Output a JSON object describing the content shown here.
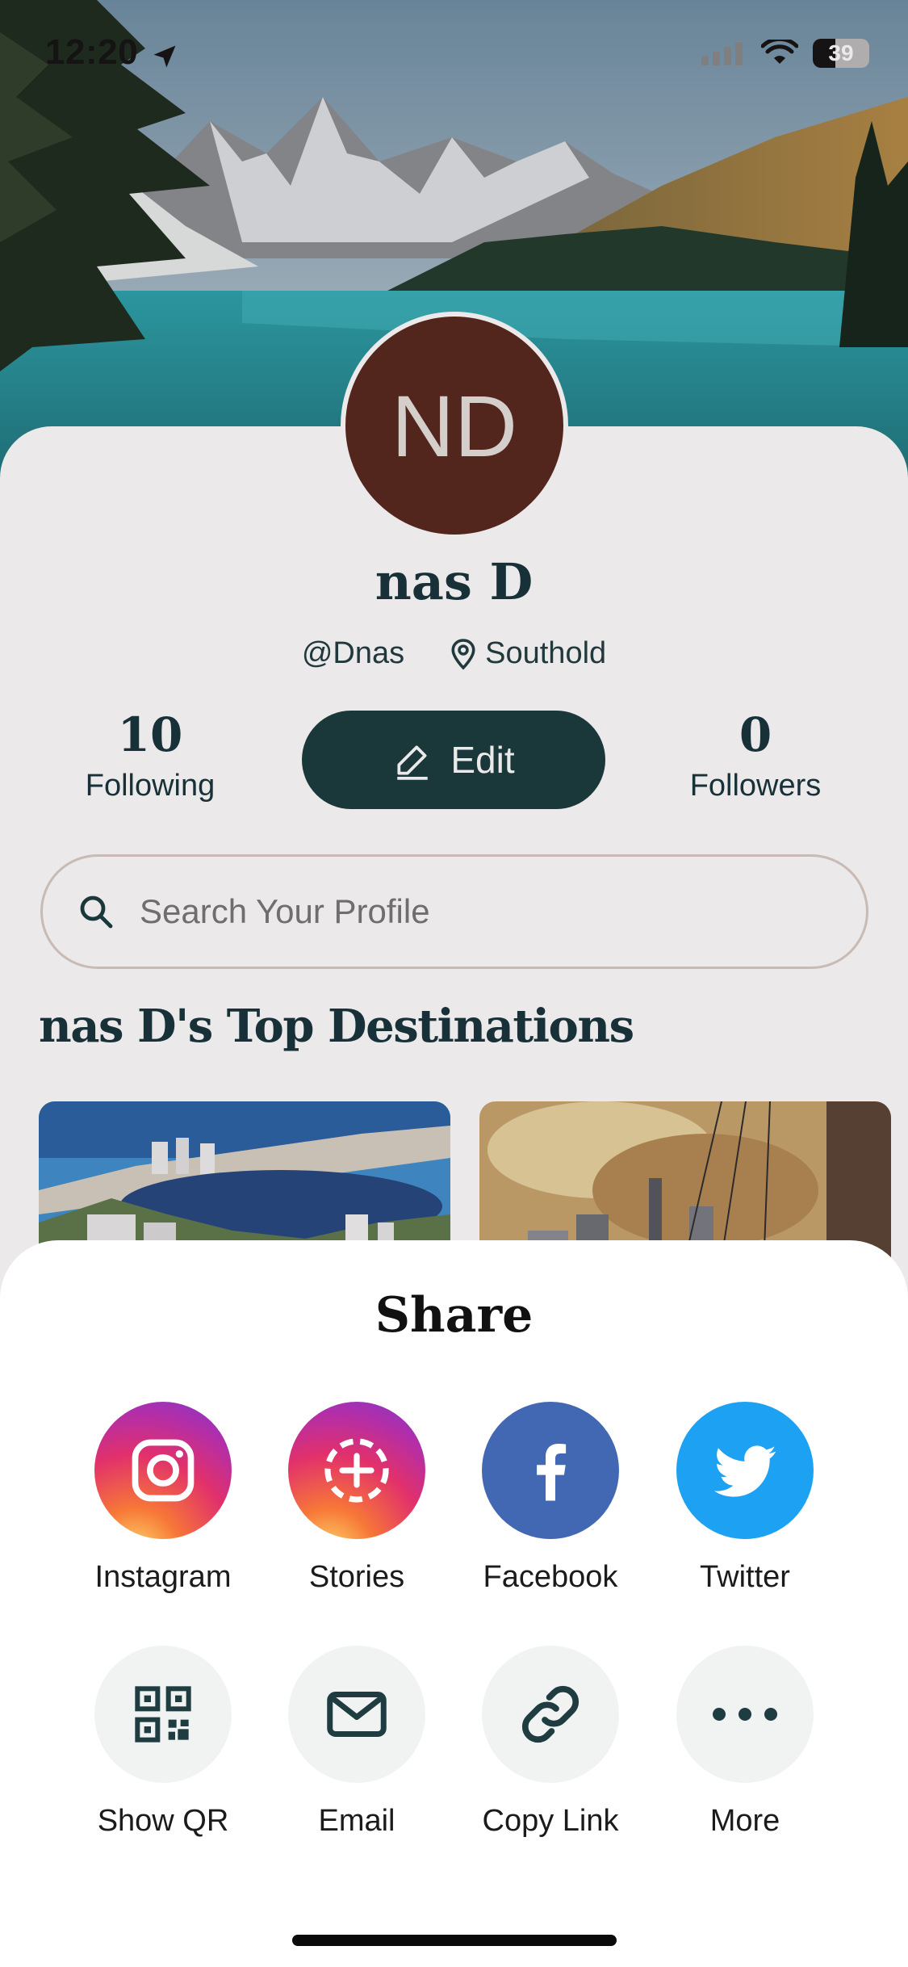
{
  "status_bar": {
    "time": "12:20",
    "battery": "39"
  },
  "profile": {
    "initials": "ND",
    "name": "nas D",
    "handle": "@Dnas",
    "location": "Southold",
    "following_count": "10",
    "following_label": "Following",
    "followers_count": "0",
    "followers_label": "Followers",
    "edit_label": "Edit",
    "search_placeholder": "Search Your Profile",
    "section_title": "nas D's Top Destinations"
  },
  "share": {
    "title": "Share",
    "row1": [
      {
        "label": "Instagram",
        "icon": "instagram-icon"
      },
      {
        "label": "Stories",
        "icon": "stories-icon"
      },
      {
        "label": "Facebook",
        "icon": "facebook-icon"
      },
      {
        "label": "Twitter",
        "icon": "twitter-icon"
      }
    ],
    "row2": [
      {
        "label": "Show QR",
        "icon": "qr-code-icon"
      },
      {
        "label": "Email",
        "icon": "envelope-icon"
      },
      {
        "label": "Copy Link",
        "icon": "link-icon"
      },
      {
        "label": "More",
        "icon": "ellipsis-icon"
      }
    ]
  },
  "colors": {
    "brand_dark": "#173a3d",
    "avatar_bg": "#56261c",
    "facebook": "#4268b3",
    "twitter": "#1da1f2"
  }
}
